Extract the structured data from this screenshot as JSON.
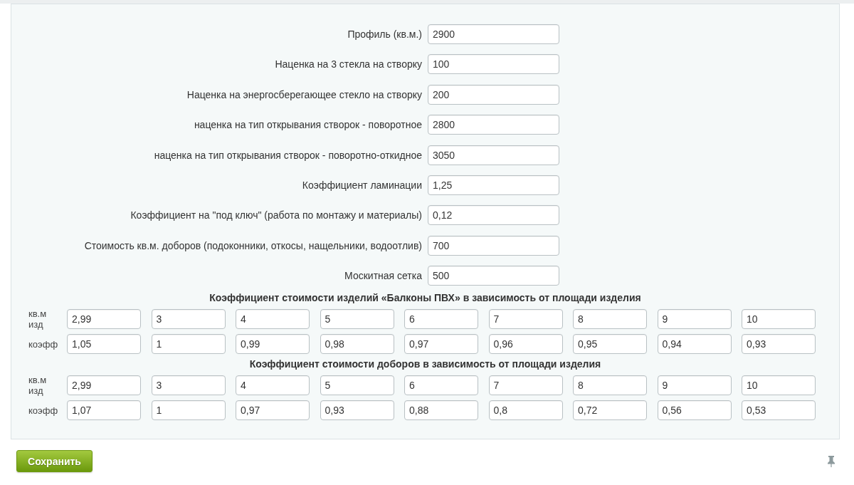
{
  "form": {
    "fields": [
      {
        "label": "Профиль (кв.м.)",
        "value": "2900"
      },
      {
        "label": "Наценка на 3 стекла на створку",
        "value": "100"
      },
      {
        "label": "Наценка на энергосберегающее стекло на створку",
        "value": "200"
      },
      {
        "label": "наценка на тип открывания створок - поворотное",
        "value": "2800"
      },
      {
        "label": "наценка на тип открывания створок - поворотно-откидное",
        "value": "3050"
      },
      {
        "label": "Коэффициент ламинации",
        "value": "1,25"
      },
      {
        "label": "Коэффициент на \"под ключ\" (работа по монтажу и материалы)",
        "value": "0,12"
      },
      {
        "label": "Стоимость кв.м. доборов (подоконники, откосы, нащельники, водоотлив)",
        "value": "700"
      },
      {
        "label": "Москитная сетка",
        "value": "500"
      }
    ]
  },
  "coefficient_tables": [
    {
      "title": "Коэффициент стоимости изделий «Балконы ПВХ» в зависимость от площади изделия",
      "rows": [
        {
          "label": "кв.м изд",
          "values": [
            "2,99",
            "3",
            "4",
            "5",
            "6",
            "7",
            "8",
            "9",
            "10"
          ]
        },
        {
          "label": "коэфф",
          "values": [
            "1,05",
            "1",
            "0,99",
            "0,98",
            "0,97",
            "0,96",
            "0,95",
            "0,94",
            "0,93"
          ]
        }
      ]
    },
    {
      "title": "Коэффициент стоимости доборов в зависимость от площади изделия",
      "rows": [
        {
          "label": "кв.м изд",
          "values": [
            "2,99",
            "3",
            "4",
            "5",
            "6",
            "7",
            "8",
            "9",
            "10"
          ]
        },
        {
          "label": "коэфф",
          "values": [
            "1,07",
            "1",
            "0,97",
            "0,93",
            "0,88",
            "0,8",
            "0,72",
            "0,56",
            "0,53"
          ]
        }
      ]
    }
  ],
  "save_button": {
    "label": "Сохранить"
  }
}
